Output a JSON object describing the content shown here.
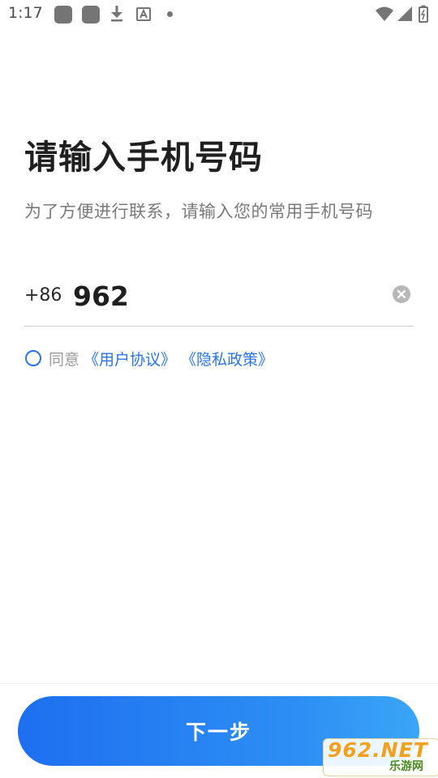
{
  "status_bar": {
    "time": "1:17",
    "icons": [
      "app-notification-icon",
      "app-notification-icon",
      "download-icon",
      "font-icon",
      "dot-icon",
      "wifi-icon",
      "signal-icon",
      "battery-icon"
    ]
  },
  "header": {
    "title": "请输入手机号码",
    "subtitle": "为了方便进行联系，请输入您的常用手机号码"
  },
  "phone": {
    "country_code": "+86",
    "value": "962",
    "clear_icon": "clear-icon"
  },
  "agreement": {
    "checked": false,
    "prefix": "同意",
    "terms_link": "《用户协议》",
    "privacy_link": "《隐私政策》"
  },
  "footer": {
    "next_label": "下一步"
  },
  "watermark": {
    "main": "962.NET",
    "sub": "乐游网"
  },
  "colors": {
    "accent": "#2a73e8",
    "button_start": "#1e6ff0",
    "button_end": "#3aa6f7",
    "title": "#1f1f1f",
    "subtitle": "#7a7a7a"
  }
}
